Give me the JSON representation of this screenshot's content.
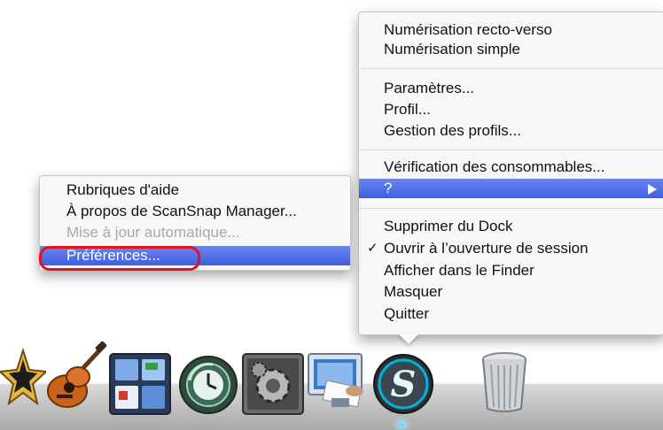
{
  "main_menu": {
    "items": [
      {
        "label": "Numérisation recto-verso",
        "enabled": true
      },
      {
        "label": "Numérisation simple",
        "enabled": true
      },
      {
        "label": "Paramètres...",
        "enabled": true
      },
      {
        "label": "Profil...",
        "enabled": true
      },
      {
        "label": "Gestion des profils...",
        "enabled": true
      },
      {
        "label": "Vérification des consommables...",
        "enabled": true
      },
      {
        "label": "?",
        "enabled": true,
        "highlighted": true,
        "has_submenu": true
      },
      {
        "label": "Supprimer du Dock",
        "enabled": true
      },
      {
        "label": "Ouvrir à l’ouverture de session",
        "enabled": true,
        "checked": true,
        "check_mark": "✓"
      },
      {
        "label": "Afficher dans le Finder",
        "enabled": true
      },
      {
        "label": "Masquer",
        "enabled": true
      },
      {
        "label": "Quitter",
        "enabled": true
      }
    ]
  },
  "help_submenu": {
    "items": [
      {
        "label": "Rubriques d'aide",
        "enabled": true
      },
      {
        "label": "À propos de ScanSnap Manager...",
        "enabled": true
      },
      {
        "label": "Mise à jour automatique...",
        "enabled": false
      },
      {
        "label": "Préférences...",
        "enabled": true,
        "highlighted": true,
        "circled": true
      }
    ]
  },
  "colors": {
    "highlight": "#4a6ae6",
    "annotation_circle": "#e0141e",
    "disabled_text": "#a8a8a8"
  },
  "dock": {
    "icons": [
      "imovie-star-icon",
      "garageband-guitar-icon",
      "dashboard-icon",
      "time-machine-icon",
      "system-preferences-icon",
      "scan-document-icon",
      "scansnap-manager-icon",
      "trash-icon"
    ],
    "active_app": "scansnap-manager-icon"
  }
}
